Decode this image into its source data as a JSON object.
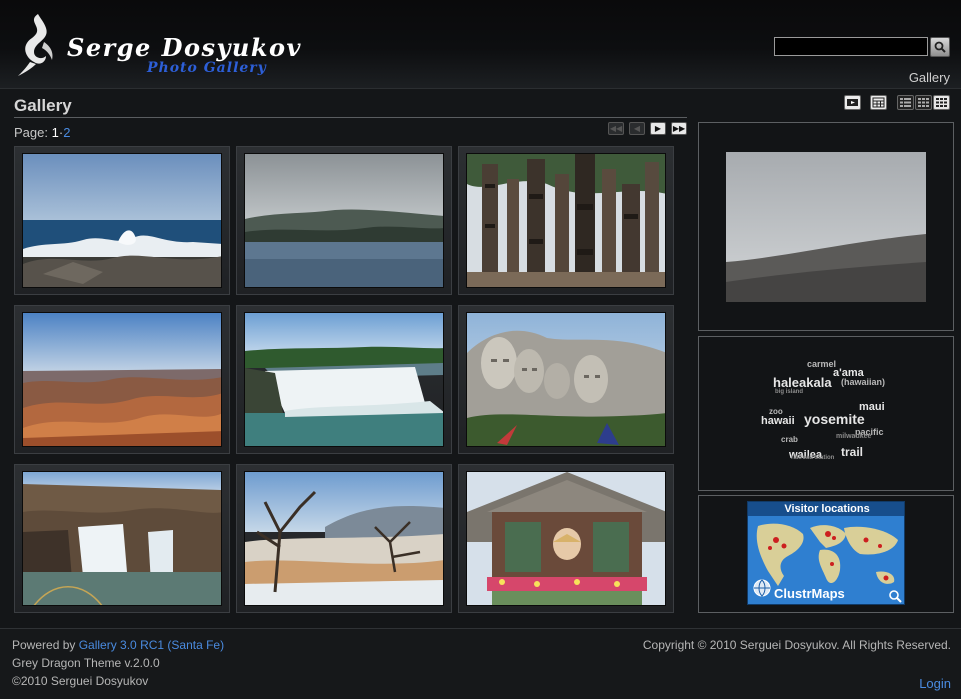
{
  "header": {
    "title": "Serge Dosyukov",
    "subtitle": "Photo Gallery",
    "search_placeholder": "",
    "breadcrumb": "Gallery",
    "logo_icon": "dragon-icon",
    "search_icon": "magnifier-icon"
  },
  "main": {
    "title": "Gallery",
    "pager": {
      "label": "Page:",
      "current": "1",
      "separator": "·",
      "next_page": "2"
    },
    "nav_icons": [
      "first-page-icon",
      "prev-page-icon",
      "next-page-icon",
      "last-page-icon"
    ],
    "view_icons": [
      "slideshow-icon",
      "calendar-icon",
      "list-view-icon",
      "grid-view-icon",
      "large-grid-icon"
    ]
  },
  "thumbnails": [
    {
      "name": "seascape-waves"
    },
    {
      "name": "bay-hills"
    },
    {
      "name": "tiki-statues"
    },
    {
      "name": "grand-canyon"
    },
    {
      "name": "niagara-falls"
    },
    {
      "name": "mount-rushmore"
    },
    {
      "name": "shoshone-falls"
    },
    {
      "name": "dead-trees-springs"
    },
    {
      "name": "gazebo-flowers"
    }
  ],
  "sidebar": {
    "tags": [
      {
        "t": "carmel",
        "s": 9
      },
      {
        "t": "a'ama",
        "s": 11
      },
      {
        "t": "haleakala",
        "s": 13
      },
      {
        "t": "(hawaiian)",
        "s": 9
      },
      {
        "t": "big island",
        "s": 6
      },
      {
        "t": "maui",
        "s": 11
      },
      {
        "t": "zoo",
        "s": 8
      },
      {
        "t": "hawaii",
        "s": 11
      },
      {
        "t": "yosemite",
        "s": 14
      },
      {
        "t": "pacific",
        "s": 9
      },
      {
        "t": "crab",
        "s": 8
      },
      {
        "t": "milwaukee",
        "s": 7
      },
      {
        "t": "wailea",
        "s": 11
      },
      {
        "t": "trail",
        "s": 12
      },
      {
        "t": "railroad station",
        "s": 6
      }
    ],
    "map": {
      "title": "Visitor locations",
      "brand": "ClustrMaps",
      "zoom_icon": "zoom-icon",
      "globe_icon": "globe-icon"
    }
  },
  "footer": {
    "powered_prefix": "Powered by ",
    "powered_link": "Gallery 3.0 RC1 (Santa Fe)",
    "theme": "Grey Dragon Theme v.2.0.0",
    "copyright_left": "©2010 Serguei Dosyukov",
    "copyright_right": "Copyright © 2010 Serguei Dosyukov. All Rights Reserved.",
    "login": "Login"
  }
}
